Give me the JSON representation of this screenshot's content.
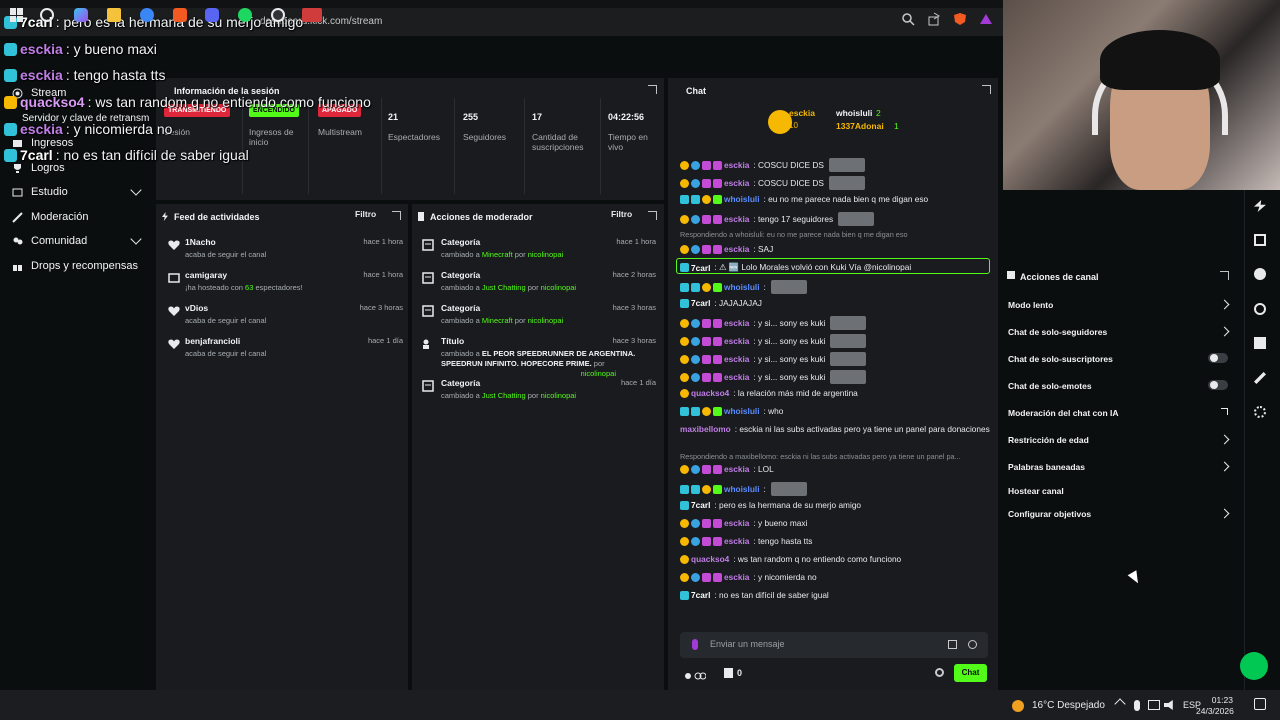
{
  "browser": {
    "url": "dashboard.kick.com/stream"
  },
  "nav": {
    "stream": "Stream",
    "stream_key": "Servidor y clave de retransm",
    "ingresos": "Ingresos",
    "logros": "Logros",
    "estudio": "Estudio",
    "moderacion": "Moderación",
    "comunidad": "Comunidad",
    "drops": "Drops y recompensas"
  },
  "session": {
    "title": "Información de la sesión",
    "session_label": "Sesión",
    "status_pill": "TRANSMITIENDO",
    "ingresos_pill": "ENCENDIDO",
    "ingresos_label_1": "Ingresos de",
    "ingresos_label_2": "inicio",
    "multistream_pill": "APAGADO",
    "multistream_label": "Multistream",
    "viewers_value": "21",
    "viewers_label": "Espectadores",
    "followers_value": "255",
    "followers_label": "Seguidores",
    "subs_value": "17",
    "subs_label_1": "Cantidad de",
    "subs_label_2": "suscripciones",
    "live_value": "04:22:56",
    "live_label_1": "Tiempo en",
    "live_label_2": "vivo"
  },
  "feed": {
    "title": "Feed de actividades",
    "filter": "Filtro",
    "items": [
      {
        "name": "1Nacho",
        "sub": "acaba de seguir el canal",
        "time": "hace 1 hora"
      },
      {
        "name": "camigaray",
        "sub_pre": "¡ha hosteado con ",
        "sub_num": "63",
        "sub_post": " espectadores!",
        "time": "hace 1 hora"
      },
      {
        "name": "vDios",
        "sub": "acaba de seguir el canal",
        "time": "hace 3 horas"
      },
      {
        "name": "benjafrancioli",
        "sub": "acaba de seguir el canal",
        "time": "hace 1 día"
      }
    ]
  },
  "modactions": {
    "title": "Acciones de moderador",
    "filter": "Filtro",
    "items": [
      {
        "name": "Categoría",
        "pre": "cambiado a ",
        "val": "Minecraft",
        "mid": " por ",
        "by": "nicolinopai",
        "time": "hace 1 hora"
      },
      {
        "name": "Categoría",
        "pre": "cambiado a ",
        "val": "Just Chatting",
        "mid": " por ",
        "by": "nicolinopai",
        "time": "hace 2 horas"
      },
      {
        "name": "Categoría",
        "pre": "cambiado a ",
        "val": "Minecraft",
        "mid": " por ",
        "by": "nicolinopai",
        "time": "hace 3 horas"
      },
      {
        "name": "Título",
        "pre": "cambiado a ",
        "val1": "EL PEOR SPEEDRUNNER DE ARGENTINA.",
        "val2": "SPEEDRUN INFINITO. HOPECORE PRIME.",
        "mid": " por ",
        "by": "nicolinopai",
        "time": "hace 3 horas"
      },
      {
        "name": "Categoría",
        "pre": "cambiado a ",
        "val": "Just Chatting",
        "mid": " por ",
        "by": "nicolinopai",
        "time": "hace 1 día"
      }
    ]
  },
  "chat": {
    "title": "Chat",
    "top_user1": "esckia",
    "top_num": "10",
    "top_user2": "whoisluli",
    "top_user3": "1337Adonai",
    "top_count2": "2",
    "top_count3": "1",
    "lines": [
      {
        "user": "esckia",
        "text": ": COSCU DICE DS",
        "color": "#c07ee6"
      },
      {
        "user": "esckia",
        "text": ": COSCU DICE DS",
        "color": "#c07ee6"
      },
      {
        "user": "whoisluli",
        "text": ": eu no me parece nada bien q me digan eso",
        "color": "#5b8cff"
      },
      {
        "user": "esckia",
        "text": ": tengo 17 seguidores",
        "color": "#c07ee6"
      },
      {
        "sys": "Respondiendo a whoisluli: eu no me parece nada bien q me digan eso"
      },
      {
        "user": "esckia",
        "text": ": SAJ",
        "color": "#c07ee6"
      },
      {
        "user": "7carl",
        "text": ": ⚠ 🆕 Lolo Morales volvió con Kuki Vía @nicolinopai",
        "color": "#ffffff"
      },
      {
        "user": "whoisluli",
        "text": ":",
        "color": "#5b8cff"
      },
      {
        "user": "7carl",
        "text": ": JAJAJAJAJ",
        "color": "#ffffff"
      },
      {
        "user": "esckia",
        "text": ": y si... sony es kuki",
        "color": "#c07ee6"
      },
      {
        "user": "esckia",
        "text": ": y si... sony es kuki",
        "color": "#c07ee6"
      },
      {
        "user": "esckia",
        "text": ": y si... sony es kuki",
        "color": "#c07ee6"
      },
      {
        "user": "esckia",
        "text": ": y si... sony es kuki",
        "color": "#c07ee6"
      },
      {
        "user": "quackso4",
        "text": ": la relación más mid de argentina",
        "color": "#c07ee6"
      },
      {
        "user": "whoisluli",
        "text": ": who",
        "color": "#5b8cff"
      },
      {
        "user": "maxibellomo",
        "text": ": esckia ni las subs activadas pero ya tiene un panel para donaciones",
        "color": "#c07ee6"
      },
      {
        "sys": "Respondiendo a maxibellomo: esckia ni las subs activadas pero ya tiene un panel pa..."
      },
      {
        "user": "esckia",
        "text": ": LOL",
        "color": "#c07ee6"
      },
      {
        "user": "whoisluli",
        "text": ":",
        "color": "#5b8cff"
      },
      {
        "user": "7carl",
        "text": ": pero es la hermana de su merjo amigo",
        "color": "#ffffff"
      },
      {
        "user": "esckia",
        "text": ": y bueno maxi",
        "color": "#c07ee6"
      },
      {
        "user": "esckia",
        "text": ": tengo hasta tts",
        "color": "#c07ee6"
      },
      {
        "user": "quackso4",
        "text": ": ws tan random q no entiendo como funciono",
        "color": "#c07ee6"
      },
      {
        "user": "esckia",
        "text": ": y nicomierda no",
        "color": "#c07ee6"
      },
      {
        "user": "7carl",
        "text": ": no es tan difícil de saber igual",
        "color": "#ffffff"
      }
    ],
    "input_placeholder": "Enviar un mensaje",
    "bottom_count": "0",
    "send": "Chat"
  },
  "channel_actions": {
    "title": "Acciones de canal",
    "rows": [
      "Modo lento",
      "Chat de solo-seguidores",
      "Chat de solo-suscriptores",
      "Chat de solo-emotes",
      "Moderación del chat con IA",
      "Restricción de edad",
      "Palabras baneadas",
      "Hostear canal",
      "Configurar objetivos"
    ]
  },
  "overlay": {
    "lines": [
      {
        "user": "7carl",
        "text": ": pero es la hermana de su merjo amigo"
      },
      {
        "user": "esckia",
        "text": ": y bueno maxi"
      },
      {
        "user": "esckia",
        "text": ": tengo hasta tts"
      },
      {
        "user": "quackso4",
        "text": ": ws tan random q no entiendo como funciono"
      },
      {
        "user": "esckia",
        "text": ": y nicomierda no"
      },
      {
        "user": "7carl",
        "text": ": no es tan difícil de saber igual"
      }
    ]
  },
  "taskbar": {
    "weather": "16°C  Despejado",
    "lang": "ESP",
    "time": "01:23",
    "date": "24/3/2026"
  }
}
